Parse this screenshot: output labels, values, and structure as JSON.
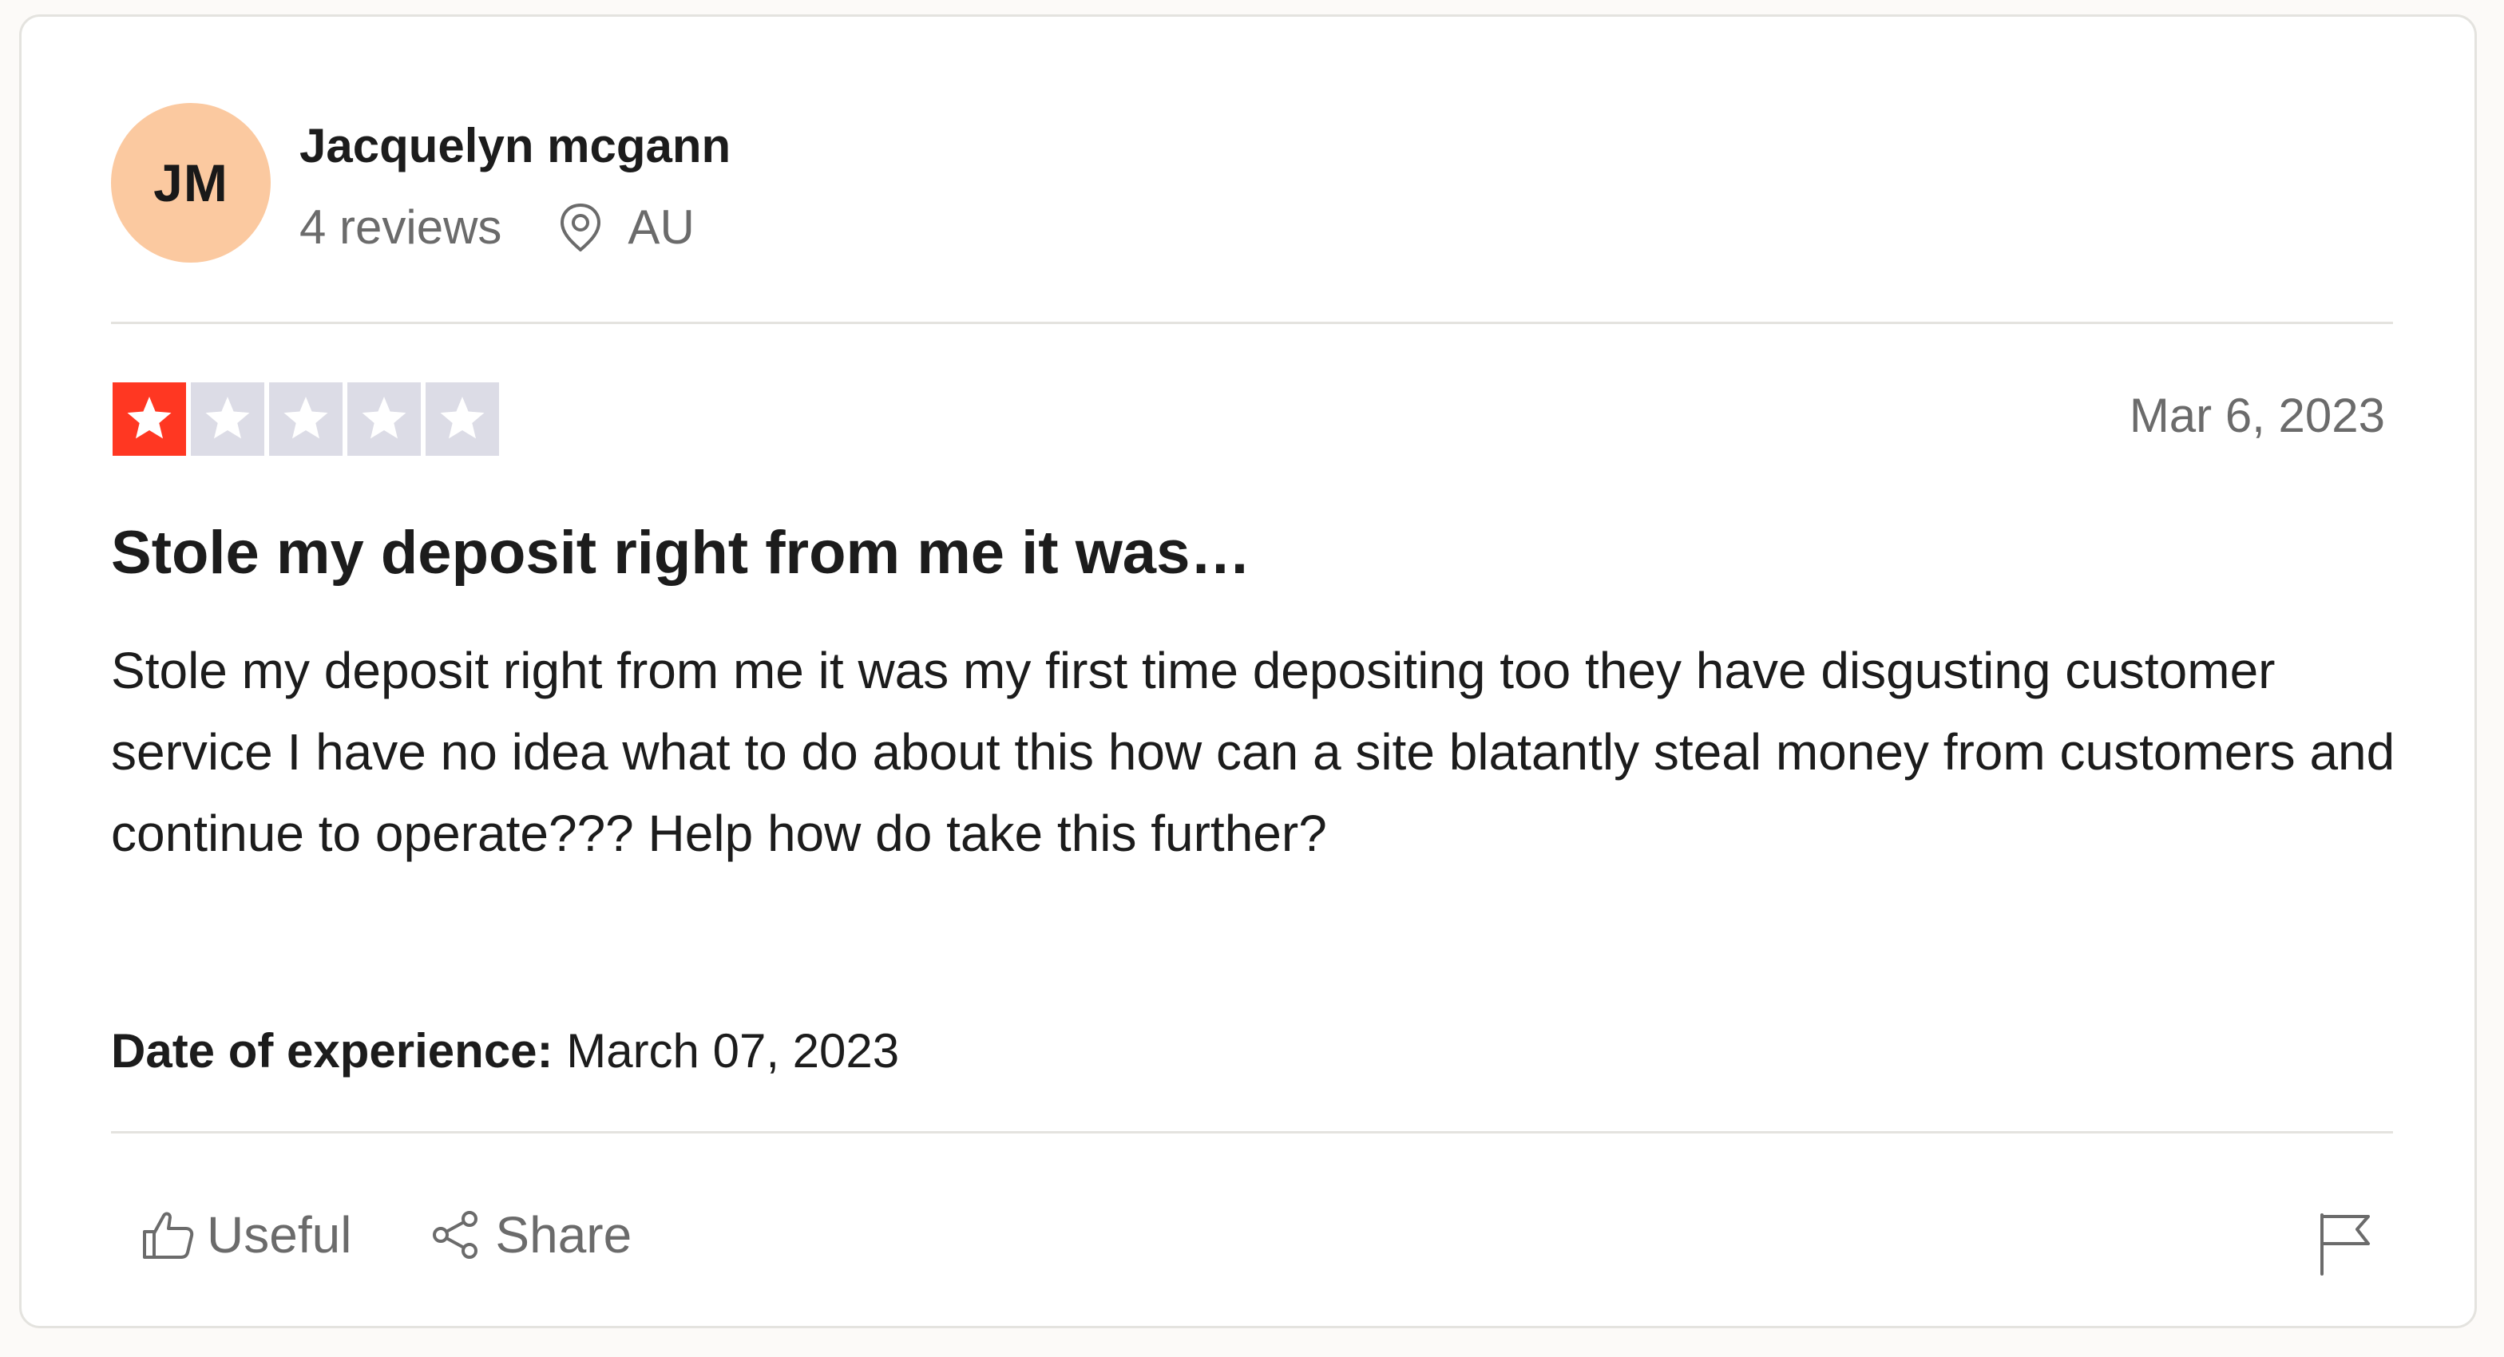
{
  "reviewer": {
    "initials": "JM",
    "name": "Jacquelyn mcgann",
    "reviews_count": "4 reviews",
    "country": "AU",
    "avatar_color": "#fbc9a0",
    "location_icon": "location-pin-icon"
  },
  "review": {
    "rating": 1,
    "max_rating": 5,
    "star_filled_color": "#ff3722",
    "star_empty_color": "#dcdce6",
    "date": "Mar 6, 2023",
    "title": "Stole my deposit right from me it was…",
    "body": "Stole my deposit right from me it was my first time depositing too they have disgusting customer service I have no idea what to do about this how can a site blatantly steal money from customers and continue to operate??? Help how do take this further?",
    "experience_label": "Date of experience:",
    "experience_date": "March 07, 2023"
  },
  "actions": {
    "useful_label": "Useful",
    "useful_icon": "thumbs-up-icon",
    "share_label": "Share",
    "share_icon": "share-icon",
    "flag_icon": "flag-icon"
  }
}
